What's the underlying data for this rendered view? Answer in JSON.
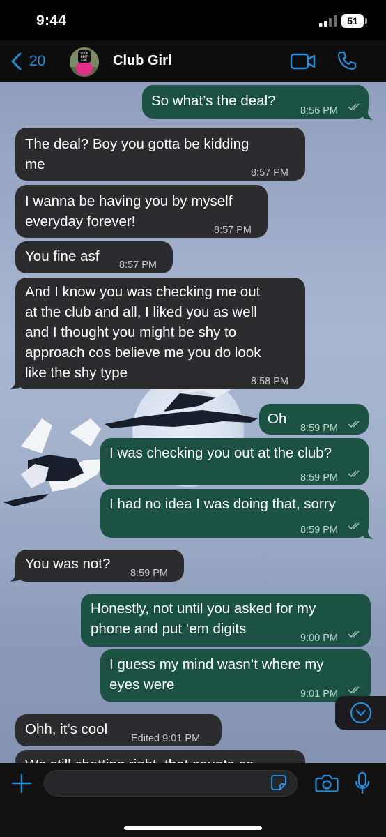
{
  "status_bar": {
    "time": "9:44",
    "battery": "51"
  },
  "header": {
    "back_count": "20",
    "contact_name": "Club Girl",
    "avatar_text": "LOOK\nBEST\nGIRL"
  },
  "messages": [
    {
      "direction": "outgoing",
      "lines": [
        "So what’s the deal?"
      ],
      "time": "8:56 PM",
      "status": "read"
    },
    {
      "direction": "incoming",
      "lines": [
        "The deal? Boy you gotta be kidding",
        "me"
      ],
      "time": "8:57 PM"
    },
    {
      "direction": "incoming",
      "lines": [
        "I wanna be having you by myself",
        "everyday forever!"
      ],
      "time": "8:57 PM"
    },
    {
      "direction": "incoming",
      "lines": [
        "You fine asf"
      ],
      "time": "8:57 PM"
    },
    {
      "direction": "incoming",
      "lines": [
        "And I know you was checking me out",
        "at the club and all, I liked you as well",
        "and I thought you might be shy to",
        "approach cos believe me you do look",
        "like the shy type"
      ],
      "time": "8:58 PM"
    },
    {
      "direction": "outgoing",
      "lines": [
        "Oh"
      ],
      "time": "8:59 PM",
      "status": "read"
    },
    {
      "direction": "outgoing",
      "lines": [
        "I was checking you out at the club?"
      ],
      "time": "8:59 PM",
      "status": "read"
    },
    {
      "direction": "outgoing",
      "lines": [
        "I had no idea I was doing that, sorry"
      ],
      "time": "8:59 PM",
      "status": "read"
    },
    {
      "direction": "incoming",
      "lines": [
        "You was not?"
      ],
      "time": "8:59 PM"
    },
    {
      "direction": "outgoing",
      "lines": [
        "Honestly, not until you asked for my",
        "phone and put ‘em digits"
      ],
      "time": "9:00 PM",
      "status": "read"
    },
    {
      "direction": "outgoing",
      "lines": [
        "I guess my mind wasn’t where my",
        "eyes were"
      ],
      "time": "9:01 PM",
      "status": "read"
    },
    {
      "direction": "incoming",
      "lines": [
        "Ohh, it’s cool"
      ],
      "time": "Edited 9:01 PM"
    },
    {
      "direction": "incoming",
      "lines": [
        "We still chatting right, that counts as"
      ],
      "time": ""
    }
  ],
  "input": {
    "value": "",
    "placeholder": ""
  },
  "colors": {
    "accent_blue": "#1f8fe0",
    "outgoing_bubble": "#1b5243",
    "incoming_bubble": "#2c2c2e",
    "read_ticks": "#9fb8b0"
  },
  "icons": {
    "back": "chevron-left-icon",
    "video": "video-camera-icon",
    "call": "phone-icon",
    "plus": "plus-icon",
    "sticker": "sticker-icon",
    "camera": "camera-icon",
    "mic": "microphone-icon",
    "scroll": "chevron-down-circle-icon"
  }
}
